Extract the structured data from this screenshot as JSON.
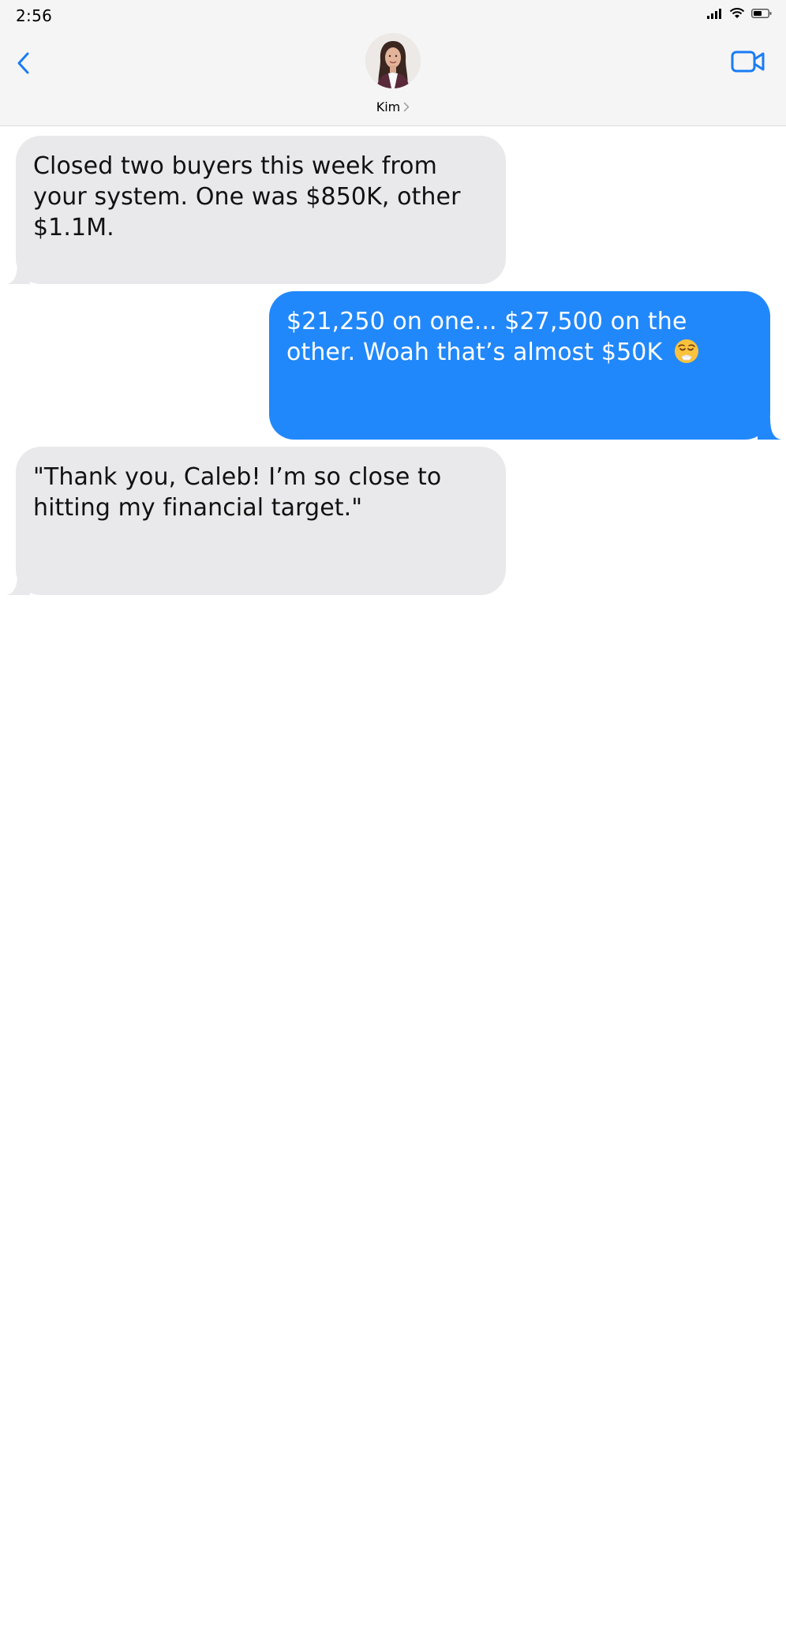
{
  "status_bar": {
    "time": "2:56",
    "icons": [
      "signal-icon",
      "wifi-icon",
      "battery-icon"
    ]
  },
  "header": {
    "back_icon": "chevron-left-icon",
    "contact_name": "Kim",
    "video_icon": "video-camera-icon"
  },
  "colors": {
    "accent": "#1a7cf5",
    "outgoing_bubble": "#2188fb",
    "incoming_bubble": "#e9e9eb",
    "header_bg": "#f5f5f5"
  },
  "messages": [
    {
      "direction": "incoming",
      "text": "Closed two buyers this week from your system. One was $850K, other $1.1M."
    },
    {
      "direction": "outgoing",
      "text": "$21,250 on one... $27,500 on the other. Woah that’s almost $50K",
      "emoji": "relieved-face-emoji"
    },
    {
      "direction": "incoming",
      "text": "\"Thank you, Caleb! I’m so close to hitting my financial target.\""
    }
  ]
}
